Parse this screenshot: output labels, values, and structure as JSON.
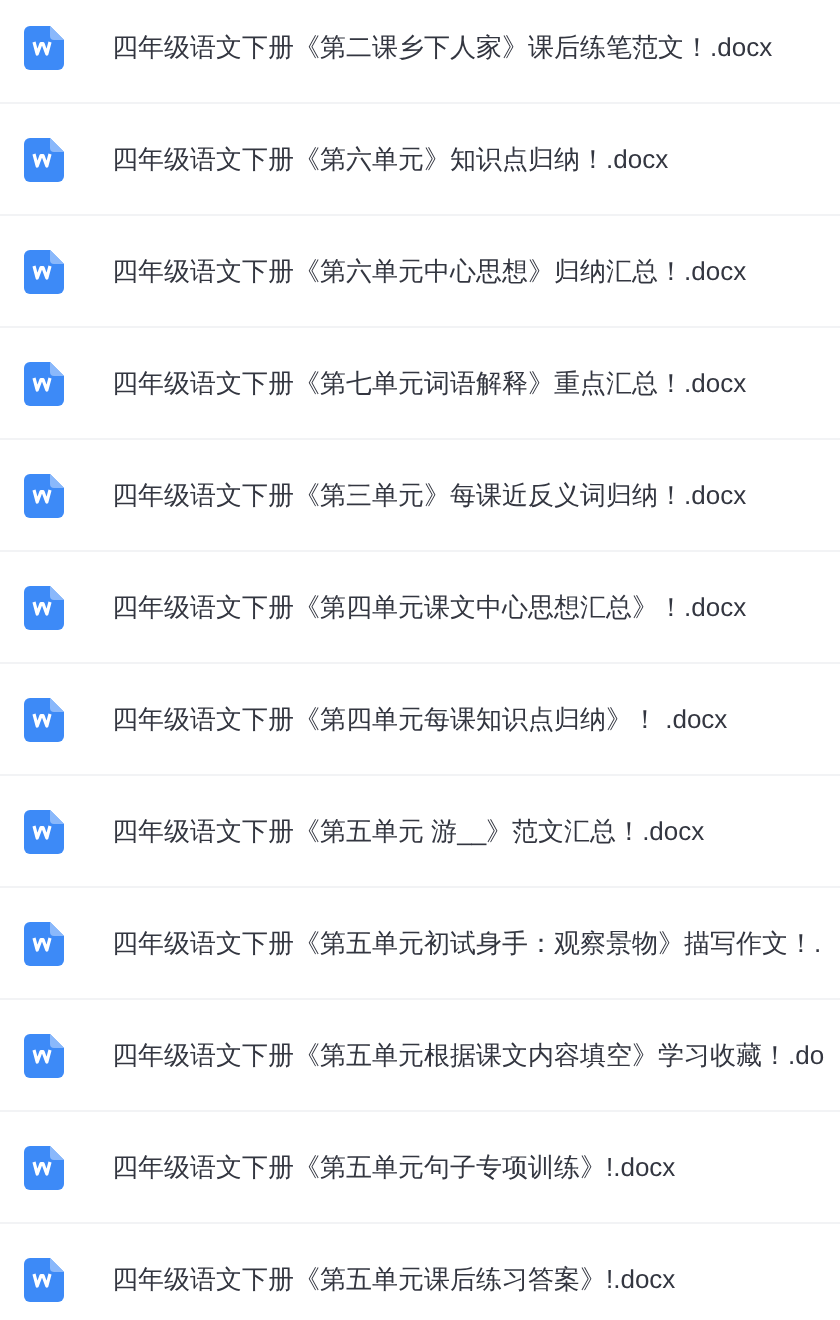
{
  "files": [
    {
      "name": "四年级语文下册《第二课乡下人家》课后练笔范文！.docx"
    },
    {
      "name": "四年级语文下册《第六单元》知识点归纳！.docx"
    },
    {
      "name": "四年级语文下册《第六单元中心思想》归纳汇总！.docx"
    },
    {
      "name": "四年级语文下册《第七单元词语解释》重点汇总！.docx"
    },
    {
      "name": "四年级语文下册《第三单元》每课近反义词归纳！.docx"
    },
    {
      "name": "四年级语文下册《第四单元课文中心思想汇总》！.docx"
    },
    {
      "name": "四年级语文下册《第四单元每课知识点归纳》！ .docx"
    },
    {
      "name": "四年级语文下册《第五单元 游__》范文汇总！.docx"
    },
    {
      "name": "四年级语文下册《第五单元初试身手：观察景物》描写作文！."
    },
    {
      "name": "四年级语文下册《第五单元根据课文内容填空》学习收藏！.do"
    },
    {
      "name": "四年级语文下册《第五单元句子专项训练》!.docx"
    },
    {
      "name": "四年级语文下册《第五单元课后练习答案》!.docx"
    }
  ]
}
